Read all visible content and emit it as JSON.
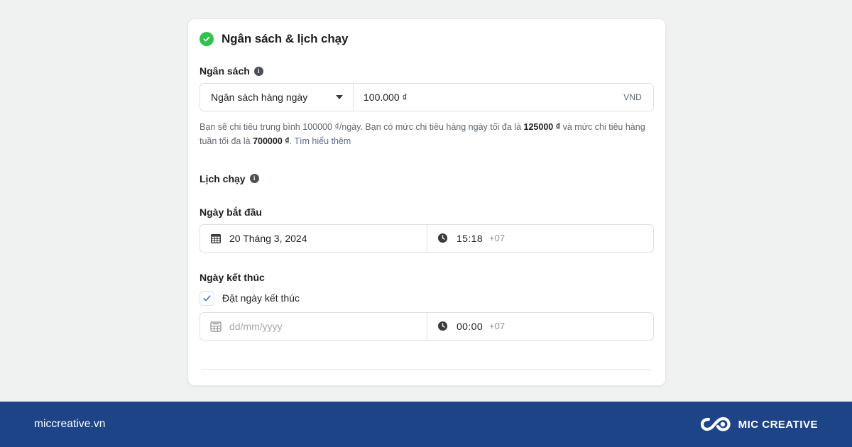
{
  "page": {
    "background_color": "#f0f2f2"
  },
  "card": {
    "section": {
      "status_icon": "check-circle-icon",
      "status_color": "#31c24d",
      "title": "Ngân sách & lịch chạy"
    },
    "budget": {
      "label": "Ngân sách",
      "info_icon": "info-icon",
      "type_selected": "Ngân sách hàng ngày",
      "dropdown_icon": "chevron-down-icon",
      "amount_value": "100.000 ₫",
      "currency": "VND",
      "helper": {
        "part1": "Bạn sẽ chi tiêu trung bình 100000 ₫/ngày. Bạn có mức chi tiêu hàng ngày tối đa là ",
        "daily_max": "125000 ₫",
        "part2": " và mức chi tiêu hàng tuần tối đa là ",
        "weekly_max": "700000 ₫",
        "part3": ". ",
        "link": "Tìm hiểu thêm"
      }
    },
    "schedule": {
      "label": "Lịch chạy",
      "info_icon": "info-icon",
      "start": {
        "label": "Ngày bắt đầu",
        "calendar_icon": "calendar-icon",
        "date_value": "20 Tháng 3, 2024",
        "clock_icon": "clock-icon",
        "time_value": "15:18",
        "timezone": "+07"
      },
      "end": {
        "label": "Ngày kết thúc",
        "checkbox_checked": true,
        "checkbox_color": "#4a7dc4",
        "checkbox_label": "Đặt ngày kết thúc",
        "calendar_icon": "calendar-icon",
        "date_placeholder": "dd/mm/yyyy",
        "clock_icon": "clock-icon",
        "time_value": "00:00",
        "timezone": "+07"
      }
    }
  },
  "footer": {
    "background_color": "#1e4488",
    "url": "miccreative.vn",
    "logo_icon": "infinity-loop-logo-icon",
    "brand_name": "MIC CREATIVE"
  }
}
